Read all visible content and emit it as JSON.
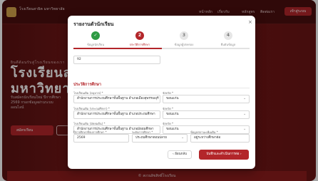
{
  "site": {
    "brand": "โรงเรียนสาธิต มหาวิทยาลัย",
    "nav": [
      "หน้าหลัก",
      "เกี่ยวกับ",
      "หลักสูตร",
      "ติดต่อเรา"
    ],
    "nav_button": "เข้าสู่ระบบ"
  },
  "hero": {
    "eyebrow": "ยินดีต้อนรับสู่โรงเรียนของเรา",
    "title_line1": "โรงเรียนสา",
    "title_line2": "มหาวิทยาลั",
    "description": "รับสมัครนักเรียนใหม่ ปีการศึกษา 2569 กรอกข้อมูลผ่านระบบออนไลน์",
    "primary_button": "สมัครเรียน"
  },
  "footer_bar": "© สงวนลิขสิทธิ์โรงเรียน",
  "modal": {
    "title": "รายงานตัวนักเรียน",
    "close_label": "×",
    "steps": [
      {
        "number": "✓",
        "label": "ข้อมูลนักเรียน",
        "state": "done"
      },
      {
        "number": "2",
        "label": "ประวัติการศึกษา",
        "state": "active"
      },
      {
        "number": "3",
        "label": "ข้อมูลผู้ปกครอง",
        "state": "idle"
      },
      {
        "number": "4",
        "label": "ยืนยันข้อมูล",
        "state": "idle"
      }
    ],
    "top_field_value": "92",
    "section_title": "ประวัติการศึกษา",
    "fields": {
      "school1_label": "โรงเรียนเดิม (อนุบาล) *",
      "school1_value": "สำนักงานการประถมศึกษาขั้นพื้นฐาน อำเภอเมืองสุพรรณบุรี",
      "prov1_label": "จังหวัด *",
      "prov1_value": "ขอนแก่น",
      "school2_label": "โรงเรียนเดิม (ประถมศึกษา) *",
      "school2_value": "สำนักงานการประถมศึกษาขั้นพื้นฐาน อำเภอประถมศึกษา",
      "prov2_label": "จังหวัด *",
      "prov2_value": "ขอนแก่น",
      "school3_label": "โรงเรียนเดิม (มัธยมต้น) *",
      "school3_value": "สำนักงานการประถมศึกษาขั้นพื้นฐาน อำเภอมัธยมศึกษา",
      "prov3_label": "จังหวัด *",
      "prov3_value": "ขอนแก่น",
      "grad_year_label": "ปีการศึกษาที่จบการศึกษา *",
      "grad_year_value": "2569",
      "level_label": "ระดับการศึกษา *",
      "level_value": "ประถมศึกษาตอนปลาย",
      "status_label": "ข้อมูลสถานะเพิ่มเติม *",
      "status_value": "อยู่ระหว่างศึกษาต่อ"
    },
    "back_button": "ย้อนกลับ",
    "next_button": "บันทึกและดำเนินการต่อ"
  }
}
